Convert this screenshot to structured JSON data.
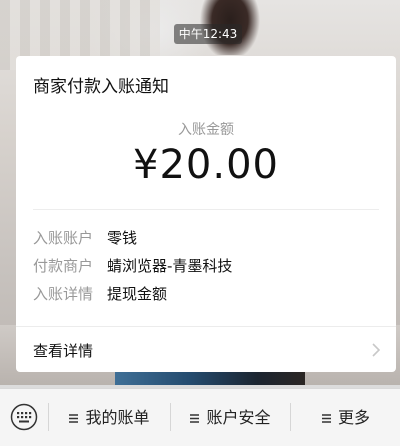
{
  "timestamp": "中午12:43",
  "card": {
    "title": "商家付款入账通知",
    "amount_label": "入账金额",
    "amount_value": "¥20.00",
    "rows": [
      {
        "key": "入账账户",
        "value": "零钱"
      },
      {
        "key": "付款商户",
        "value": "蜻浏览器-青墨科技"
      },
      {
        "key": "入账详情",
        "value": "提现金额"
      }
    ],
    "detail_link": "查看详情"
  },
  "bottom_menu": {
    "items": [
      "我的账单",
      "账户安全",
      "更多"
    ]
  },
  "icons": {
    "keyboard": "keyboard-icon",
    "chevron": "chevron-right-icon",
    "hamburger": "menu-icon"
  }
}
